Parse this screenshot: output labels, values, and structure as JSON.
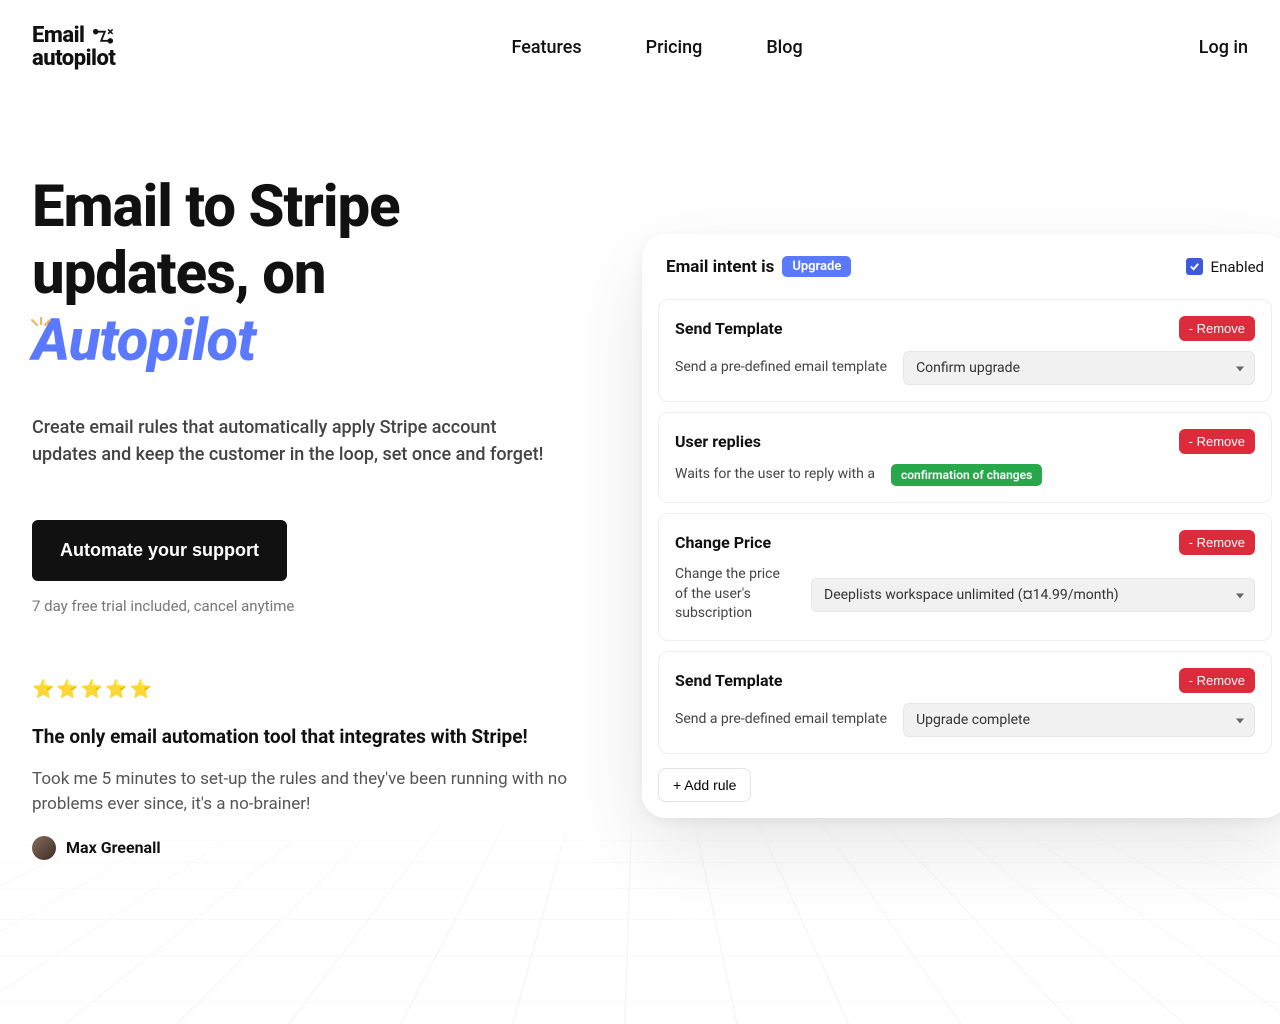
{
  "logo": {
    "line1": "Email",
    "line2": "autopilot"
  },
  "nav": {
    "features": "Features",
    "pricing": "Pricing",
    "blog": "Blog",
    "login": "Log in"
  },
  "hero": {
    "headline1": "Email to Stripe",
    "headline2": "updates, on",
    "headline3_autopilot": "Autopilot",
    "sparkle_icon": "sparkle-icon",
    "subhead": "Create email rules that automatically apply Stripe account updates and keep the customer in the loop, set once and forget!",
    "cta": "Automate your support",
    "trial_note": "7 day free trial included, cancel anytime",
    "stars": "⭐⭐⭐⭐⭐",
    "testimonial_title": "The only email automation tool that integrates with Stripe!",
    "testimonial_body": "Took me 5 minutes to set-up the rules and they've been running with no problems ever since, it's a no-brainer!",
    "testimonial_author": "Max Greenall"
  },
  "panel": {
    "intent_prefix": "Email intent is",
    "intent_badge": "Upgrade",
    "enabled_label": "Enabled",
    "enabled_checked": true,
    "remove_label": "-  Remove",
    "add_rule_label": "+   Add rule",
    "rules": [
      {
        "title": "Send Template",
        "desc": "Send a pre-defined email template",
        "select_value": "Confirm upgrade",
        "kind": "select"
      },
      {
        "title": "User replies",
        "desc": "Waits for the user to reply with a",
        "badge": "confirmation of changes",
        "kind": "badge"
      },
      {
        "title": "Change Price",
        "desc": "Change the price of the user's subscription",
        "select_value": "Deeplists workspace unlimited (¤14.99/month)",
        "kind": "select-wide"
      },
      {
        "title": "Send Template",
        "desc": "Send a pre-defined email template",
        "select_value": "Upgrade complete",
        "kind": "select"
      }
    ]
  }
}
